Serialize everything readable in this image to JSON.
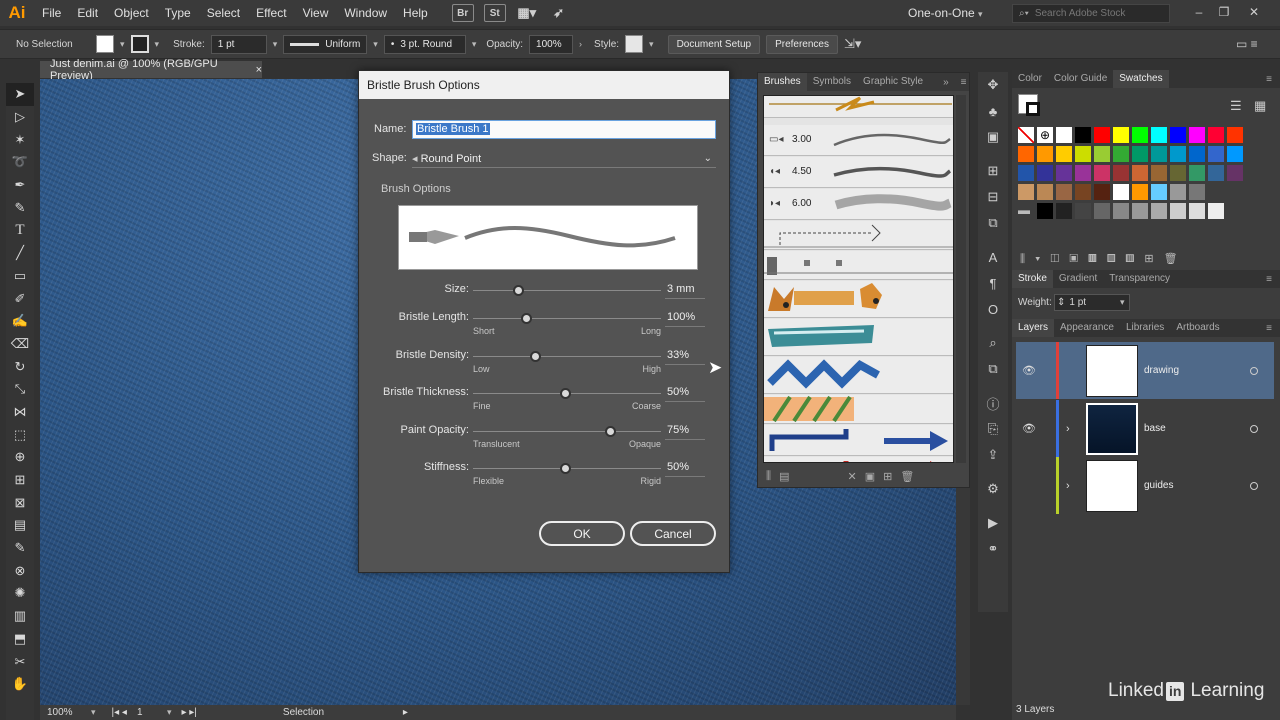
{
  "app": {
    "logo": "Ai"
  },
  "menu": [
    "File",
    "Edit",
    "Object",
    "Type",
    "Select",
    "Effect",
    "View",
    "Window",
    "Help"
  ],
  "menubar_icons": [
    "Br",
    "St"
  ],
  "workspace": "One-on-One",
  "search_placeholder": "Search Adobe Stock",
  "control": {
    "selection": "No Selection",
    "stroke_label": "Stroke:",
    "stroke_value": "1 pt",
    "profile": "Uniform",
    "brush": "3 pt. Round",
    "opacity_label": "Opacity:",
    "opacity_value": "100%",
    "style_label": "Style:",
    "doc_setup": "Document Setup",
    "preferences": "Preferences"
  },
  "doc_tab": {
    "title": "Just denim.ai @ 100% (RGB/GPU Preview)",
    "close": "×"
  },
  "dialog": {
    "title": "Bristle Brush Options",
    "name_label": "Name:",
    "name_value": "Bristle Brush 1",
    "shape_label": "Shape:",
    "shape_value": "Round Point",
    "section": "Brush Options",
    "sliders": [
      {
        "label": "Size:",
        "value": "3 mm",
        "min": "",
        "max": "",
        "level": 0.24
      },
      {
        "label": "Bristle Length:",
        "value": "100%",
        "min": "Short",
        "max": "Long",
        "level": 0.28
      },
      {
        "label": "Bristle Density:",
        "value": "33%",
        "min": "Low",
        "max": "High",
        "level": 0.33
      },
      {
        "label": "Bristle Thickness:",
        "value": "50%",
        "min": "Fine",
        "max": "Coarse",
        "level": 0.49
      },
      {
        "label": "Paint Opacity:",
        "value": "75%",
        "min": "Translucent",
        "max": "Opaque",
        "level": 0.73
      },
      {
        "label": "Stiffness:",
        "value": "50%",
        "min": "Flexible",
        "max": "Rigid",
        "level": 0.49
      }
    ],
    "ok": "OK",
    "cancel": "Cancel"
  },
  "brushes_panel": {
    "tabs": [
      "Brushes",
      "Symbols",
      "Graphic Style"
    ],
    "sizes": [
      "3.00",
      "4.50",
      "6.00"
    ]
  },
  "color_panel": {
    "tabs": [
      "Color",
      "Color Guide",
      "Swatches"
    ]
  },
  "stroke_panel": {
    "tabs": [
      "Stroke",
      "Gradient",
      "Transparency"
    ],
    "weight_label": "Weight:",
    "weight_value": "1 pt"
  },
  "layers_panel": {
    "tabs": [
      "Layers",
      "Appearance",
      "Libraries",
      "Artboards"
    ],
    "layers": [
      {
        "name": "drawing",
        "color": "#e0403a"
      },
      {
        "name": "base",
        "color": "#3a6fe0"
      },
      {
        "name": "guides",
        "color": "#b9d12a"
      }
    ],
    "count": "3 Layers"
  },
  "status": {
    "zoom": "100%",
    "artboard": "1",
    "tool": "Selection"
  },
  "watermark": {
    "linked": "Linked",
    "in": "in",
    "learning": "Learning"
  }
}
